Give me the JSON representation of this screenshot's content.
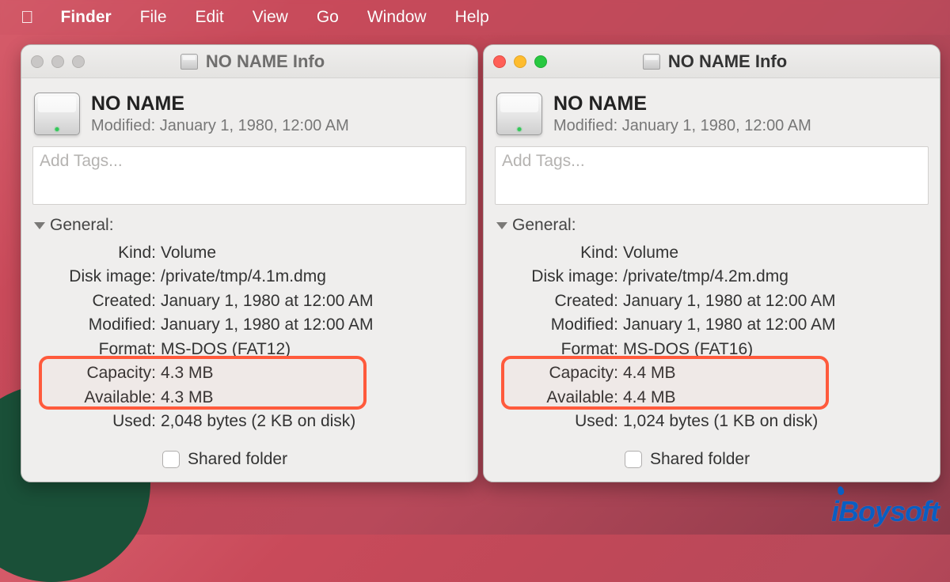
{
  "menubar": {
    "app": "Finder",
    "items": [
      "File",
      "Edit",
      "View",
      "Go",
      "Window",
      "Help"
    ]
  },
  "windows": [
    {
      "active": false,
      "title": "NO NAME Info",
      "volume_name": "NO NAME",
      "modified_line": "Modified: January 1, 1980, 12:00 AM",
      "tags_placeholder": "Add Tags...",
      "section": "General:",
      "kv": [
        {
          "k": "Kind:",
          "v": "Volume"
        },
        {
          "k": "Disk image:",
          "v": "/private/tmp/4.1m.dmg"
        },
        {
          "k": "Created:",
          "v": "January 1, 1980 at 12:00 AM"
        },
        {
          "k": "Modified:",
          "v": "January 1, 1980 at 12:00 AM"
        },
        {
          "k": "Format:",
          "v": "MS-DOS (FAT12)"
        },
        {
          "k": "Capacity:",
          "v": "4.3 MB"
        },
        {
          "k": "Available:",
          "v": "4.3 MB"
        },
        {
          "k": "Used:",
          "v": "2,048 bytes (2 KB on disk)"
        }
      ],
      "shared_label": "Shared folder"
    },
    {
      "active": true,
      "title": "NO NAME Info",
      "volume_name": "NO NAME",
      "modified_line": "Modified: January 1, 1980, 12:00 AM",
      "tags_placeholder": "Add Tags...",
      "section": "General:",
      "kv": [
        {
          "k": "Kind:",
          "v": "Volume"
        },
        {
          "k": "Disk image:",
          "v": "/private/tmp/4.2m.dmg"
        },
        {
          "k": "Created:",
          "v": "January 1, 1980 at 12:00 AM"
        },
        {
          "k": "Modified:",
          "v": "January 1, 1980 at 12:00 AM"
        },
        {
          "k": "Format:",
          "v": "MS-DOS (FAT16)"
        },
        {
          "k": "Capacity:",
          "v": "4.4 MB"
        },
        {
          "k": "Available:",
          "v": "4.4 MB"
        },
        {
          "k": "Used:",
          "v": "1,024 bytes (1 KB on disk)"
        }
      ],
      "shared_label": "Shared folder"
    }
  ],
  "watermark": "iBoysoft"
}
